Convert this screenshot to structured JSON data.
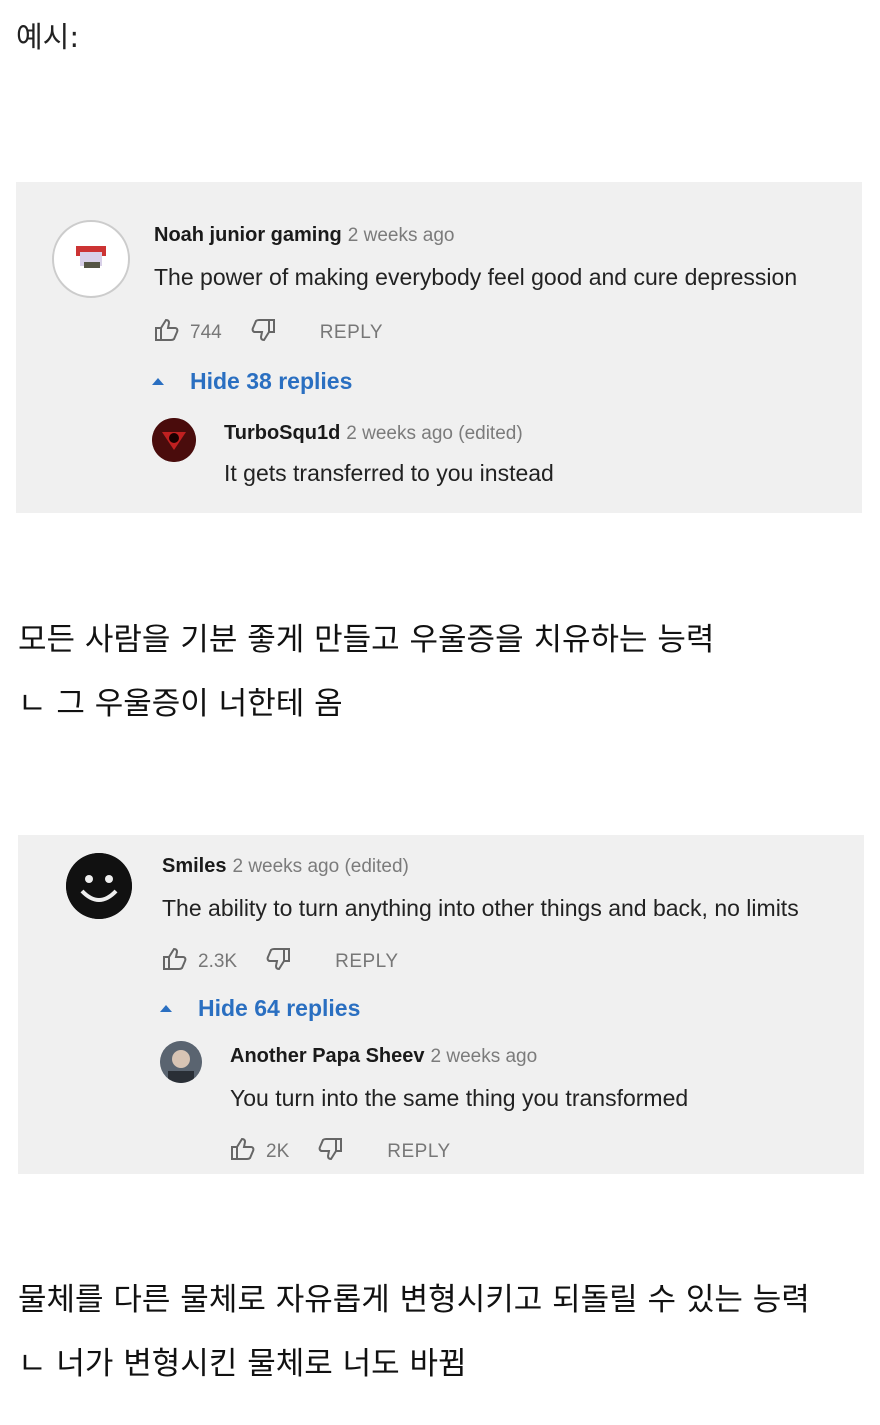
{
  "intro": "예시:",
  "thread1": {
    "comment": {
      "author": "Noah junior gaming",
      "time": "2 weeks ago",
      "text": "The power of making everybody feel good and cure depression",
      "likes": "744",
      "reply_label": "REPLY"
    },
    "hide_label": "Hide 38 replies",
    "reply": {
      "author": "TurboSqu1d",
      "time": "2 weeks ago (edited)",
      "text": "It gets transferred to you instead"
    }
  },
  "caption1": {
    "line1": "모든 사람을 기분 좋게 만들고 우울증을 치유하는 능력",
    "line2": "ㄴ 그 우울증이 너한테 옴"
  },
  "thread2": {
    "comment": {
      "author": "Smiles",
      "time": "2 weeks ago (edited)",
      "text": "The ability to turn anything into other things and back, no limits",
      "likes": "2.3K",
      "reply_label": "REPLY"
    },
    "hide_label": "Hide 64 replies",
    "reply": {
      "author": "Another Papa Sheev",
      "time": "2 weeks ago",
      "text": "You turn into the same thing you transformed",
      "likes": "2K",
      "reply_label": "REPLY"
    }
  },
  "caption2": {
    "line1": "물체를 다른 물체로 자유롭게 변형시키고 되돌릴 수 있는 능력",
    "line2": "ㄴ 너가 변형시킨 물체로 너도 바뀜"
  },
  "colors": {
    "link": "#2a6fc1",
    "panel": "#f0f0f0",
    "meta": "#7b7b7b"
  },
  "icons": [
    "thumbs-up-icon",
    "thumbs-down-icon",
    "caret-up-icon"
  ]
}
